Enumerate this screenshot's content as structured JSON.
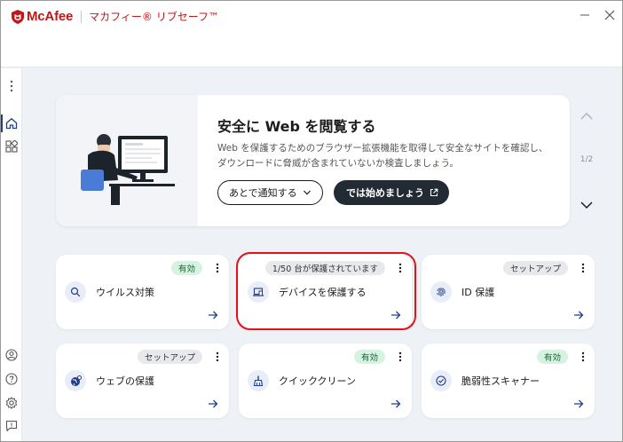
{
  "app": {
    "brand": "McAfee",
    "product": "マカフィー® リブセーフ™",
    "brand_color": "#c01818"
  },
  "window_controls": {
    "minimize_icon": "minimize-icon",
    "close_icon": "close-icon"
  },
  "sidebar": {
    "items": [
      {
        "name": "more-vertical-icon"
      },
      {
        "name": "home-icon",
        "active": true
      },
      {
        "name": "apps-grid-icon"
      },
      {
        "name": "account-icon"
      },
      {
        "name": "help-icon"
      },
      {
        "name": "settings-icon"
      },
      {
        "name": "feedback-icon"
      }
    ]
  },
  "banner": {
    "title": "安全に Web を閲覧する",
    "description": "Web を保護するためのブラウザー拡張機能を取得して安全なサイトを確認し、ダウンロードに脅威が含まれていないか検査しましょう。",
    "secondary_button": "あとで通知する",
    "primary_button": "では始めましょう",
    "pager": "1/2"
  },
  "cards": [
    {
      "label": "ウイルス対策",
      "badge": "有効",
      "badge_style": "green",
      "icon": "search-icon"
    },
    {
      "label": "デバイスを保護する",
      "badge": "1/50 台が保護されています",
      "badge_style": "gray",
      "icon": "laptop-icon"
    },
    {
      "label": "ID 保護",
      "badge": "セットアップ",
      "badge_style": "gray",
      "icon": "fingerprint-icon"
    },
    {
      "label": "ウェブの保護",
      "badge": "セットアップ",
      "badge_style": "gray",
      "icon": "globe-icon"
    },
    {
      "label": "クイッククリーン",
      "badge": "有効",
      "badge_style": "green",
      "icon": "broom-icon"
    },
    {
      "label": "脆弱性スキャナー",
      "badge": "有効",
      "badge_style": "green",
      "icon": "check-circle-icon"
    }
  ],
  "colors": {
    "accent": "#1f3e8c",
    "highlight": "#e2141b",
    "badge_green": "#d6f3e1"
  }
}
